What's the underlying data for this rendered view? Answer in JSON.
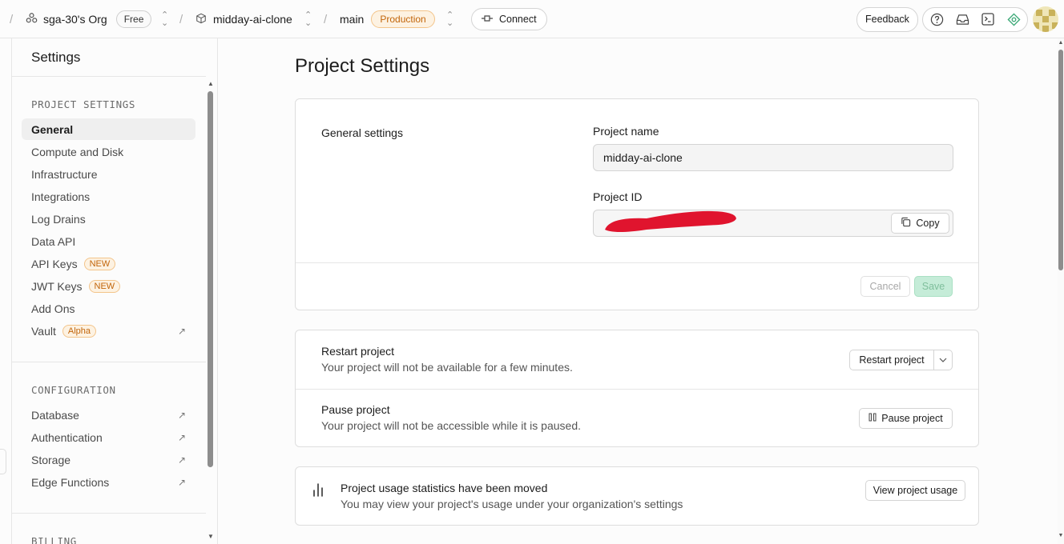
{
  "topbar": {
    "org_name": "sga-30's Org",
    "org_plan": "Free",
    "project_name": "midday-ai-clone",
    "branch": "main",
    "environment": "Production",
    "connect_label": "Connect",
    "feedback_label": "Feedback",
    "separator": "/"
  },
  "sidebar": {
    "title": "Settings",
    "sections": [
      {
        "heading": "PROJECT SETTINGS",
        "items": [
          {
            "label": "General"
          },
          {
            "label": "Compute and Disk"
          },
          {
            "label": "Infrastructure"
          },
          {
            "label": "Integrations"
          },
          {
            "label": "Log Drains"
          },
          {
            "label": "Data API"
          },
          {
            "label": "API Keys",
            "badge": "NEW"
          },
          {
            "label": "JWT Keys",
            "badge": "NEW"
          },
          {
            "label": "Add Ons"
          },
          {
            "label": "Vault",
            "badge": "Alpha"
          }
        ]
      },
      {
        "heading": "CONFIGURATION",
        "items": [
          {
            "label": "Database"
          },
          {
            "label": "Authentication"
          },
          {
            "label": "Storage"
          },
          {
            "label": "Edge Functions"
          }
        ]
      },
      {
        "heading": "BILLING",
        "items": []
      }
    ]
  },
  "main": {
    "page_title": "Project Settings",
    "general": {
      "section_label": "General settings",
      "project_name_label": "Project name",
      "project_name_value": "midday-ai-clone",
      "project_id_label": "Project ID",
      "copy_label": "Copy",
      "cancel_label": "Cancel",
      "save_label": "Save"
    },
    "restart": {
      "title": "Restart project",
      "description": "Your project will not be available for a few minutes.",
      "button_label": "Restart project"
    },
    "pause": {
      "title": "Pause project",
      "description": "Your project will not be accessible while it is paused.",
      "button_label": "Pause project"
    },
    "usage": {
      "title": "Project usage statistics have been moved",
      "description": "You may view your project's usage under your organization's settings",
      "button_label": "View project usage"
    }
  },
  "colors": {
    "accent_orange": "#c2650a",
    "save_green": "#c5ecd8",
    "redaction_red": "#e0142e"
  }
}
